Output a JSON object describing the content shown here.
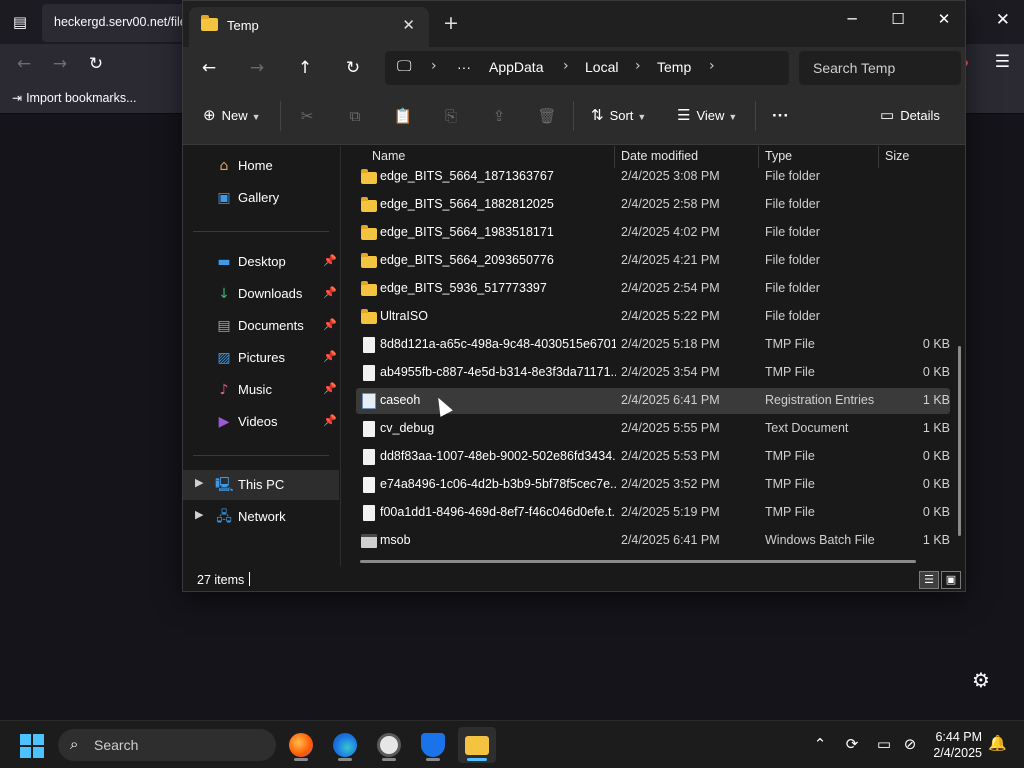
{
  "browser": {
    "tab_title": "heckergd.serv00.net/file",
    "bookmark_label": "Import bookmarks...",
    "close_symbol": "✕",
    "icons": [
      "tab-overview-icon",
      "back-icon",
      "forward-icon",
      "reload-icon",
      "menu-icon",
      "settings-gear-icon"
    ]
  },
  "explorer": {
    "tab_title": "Temp",
    "path": [
      "AppData",
      "Local",
      "Temp"
    ],
    "path_overflow": "···",
    "search_placeholder": "Search Temp",
    "toolbar": {
      "new_label": "New",
      "sort_label": "Sort",
      "view_label": "View",
      "more_label": "···",
      "details_label": "Details"
    },
    "nav_pane": {
      "top": [
        {
          "label": "Home",
          "icon": "home-icon"
        },
        {
          "label": "Gallery",
          "icon": "gallery-icon"
        }
      ],
      "pinned": [
        {
          "label": "Desktop",
          "icon": "desktop-icon"
        },
        {
          "label": "Downloads",
          "icon": "downloads-icon"
        },
        {
          "label": "Documents",
          "icon": "documents-icon"
        },
        {
          "label": "Pictures",
          "icon": "pictures-icon"
        },
        {
          "label": "Music",
          "icon": "music-icon"
        },
        {
          "label": "Videos",
          "icon": "videos-icon"
        }
      ],
      "bottom": [
        {
          "label": "This PC",
          "icon": "this-pc-icon",
          "selected": true
        },
        {
          "label": "Network",
          "icon": "network-icon"
        }
      ]
    },
    "columns": [
      "Name",
      "Date modified",
      "Type",
      "Size"
    ],
    "files": [
      {
        "name": "edge_BITS_5664_1871363767",
        "date": "2/4/2025 3:08 PM",
        "type": "File folder",
        "size": "",
        "kind": "folder"
      },
      {
        "name": "edge_BITS_5664_1882812025",
        "date": "2/4/2025 2:58 PM",
        "type": "File folder",
        "size": "",
        "kind": "folder"
      },
      {
        "name": "edge_BITS_5664_1983518171",
        "date": "2/4/2025 4:02 PM",
        "type": "File folder",
        "size": "",
        "kind": "folder"
      },
      {
        "name": "edge_BITS_5664_2093650776",
        "date": "2/4/2025 4:21 PM",
        "type": "File folder",
        "size": "",
        "kind": "folder"
      },
      {
        "name": "edge_BITS_5936_517773397",
        "date": "2/4/2025 2:54 PM",
        "type": "File folder",
        "size": "",
        "kind": "folder"
      },
      {
        "name": "UltraISO",
        "date": "2/4/2025 5:22 PM",
        "type": "File folder",
        "size": "",
        "kind": "folder"
      },
      {
        "name": "8d8d121a-a65c-498a-9c48-4030515e6701....",
        "date": "2/4/2025 5:18 PM",
        "type": "TMP File",
        "size": "0 KB",
        "kind": "file"
      },
      {
        "name": "ab4955fb-c887-4e5d-b314-8e3f3da71171....",
        "date": "2/4/2025 3:54 PM",
        "type": "TMP File",
        "size": "0 KB",
        "kind": "file"
      },
      {
        "name": "caseoh",
        "date": "2/4/2025 6:41 PM",
        "type": "Registration Entries",
        "size": "1 KB",
        "kind": "reg",
        "selected": true
      },
      {
        "name": "cv_debug",
        "date": "2/4/2025 5:55 PM",
        "type": "Text Document",
        "size": "1 KB",
        "kind": "file"
      },
      {
        "name": "dd8f83aa-1007-48eb-9002-502e86fd3434....",
        "date": "2/4/2025 5:53 PM",
        "type": "TMP File",
        "size": "0 KB",
        "kind": "file"
      },
      {
        "name": "e74a8496-1c06-4d2b-b3b9-5bf78f5cec7e....",
        "date": "2/4/2025 3:52 PM",
        "type": "TMP File",
        "size": "0 KB",
        "kind": "file"
      },
      {
        "name": "f00a1dd1-8496-469d-8ef7-f46c046d0efe.t...",
        "date": "2/4/2025 5:19 PM",
        "type": "TMP File",
        "size": "0 KB",
        "kind": "file"
      },
      {
        "name": "msob",
        "date": "2/4/2025 6:41 PM",
        "type": "Windows Batch File",
        "size": "1 KB",
        "kind": "bat"
      }
    ],
    "status_text": "27 items"
  },
  "taskbar": {
    "search_label": "Search",
    "time": "6:44 PM",
    "date": "2/4/2025",
    "apps": [
      "firefox-icon",
      "edge-icon",
      "clock-icon",
      "defender-icon",
      "file-explorer-icon"
    ],
    "accent_color": "#4cc2ff"
  }
}
